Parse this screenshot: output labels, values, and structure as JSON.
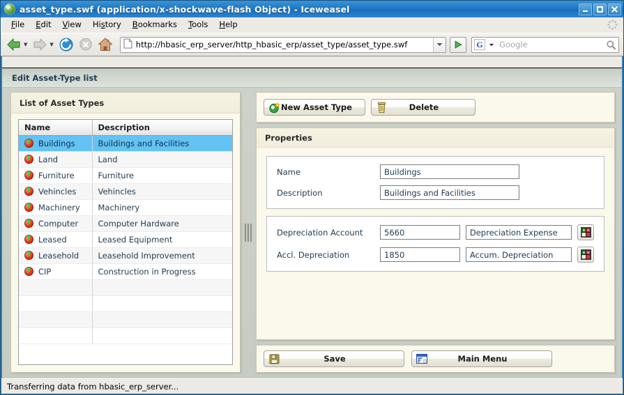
{
  "window": {
    "title": "asset_type.swf (application/x-shockwave-flash Object) - Iceweasel",
    "app_icon": "globe-icon",
    "minimize_label": "minimize-icon",
    "maximize_label": "maximize-icon",
    "close_label": "close-icon"
  },
  "menubar": {
    "items": [
      {
        "label": "File",
        "accel": "F"
      },
      {
        "label": "Edit",
        "accel": "E"
      },
      {
        "label": "View",
        "accel": "V"
      },
      {
        "label": "History",
        "accel": "s"
      },
      {
        "label": "Bookmarks",
        "accel": "B"
      },
      {
        "label": "Tools",
        "accel": "T"
      },
      {
        "label": "Help",
        "accel": "H"
      }
    ],
    "throbber": "throbber-icon"
  },
  "navbar": {
    "back": "back-arrow-icon",
    "forward": "forward-arrow-icon",
    "reload": "reload-icon",
    "stop": "stop-icon",
    "home": "home-icon",
    "url_value": "http://hbasic_erp_server/http_hbasic_erp/asset_type/asset_type.swf",
    "url_icon": "page-icon",
    "go": "go-icon",
    "search_engine": "G",
    "search_placeholder": "Google",
    "search_value": "",
    "search_icon": "magnifier-icon"
  },
  "app": {
    "header_title": "Edit Asset-Type list",
    "left": {
      "title": "List of Asset Types",
      "columns": [
        "Name",
        "Description"
      ],
      "rows": [
        {
          "icon": "asset-type-icon",
          "name": "Buildings",
          "description": "Buildings and Facilities",
          "selected": true
        },
        {
          "icon": "asset-type-icon",
          "name": "Land",
          "description": "Land",
          "selected": false
        },
        {
          "icon": "asset-type-icon",
          "name": "Furniture",
          "description": "Furniture",
          "selected": false
        },
        {
          "icon": "asset-type-icon",
          "name": "Vehincles",
          "description": "Vehincles",
          "selected": false
        },
        {
          "icon": "asset-type-icon",
          "name": "Machinery",
          "description": "Machinery",
          "selected": false
        },
        {
          "icon": "asset-type-icon",
          "name": "Computer",
          "description": "Computer Hardware",
          "selected": false
        },
        {
          "icon": "asset-type-icon",
          "name": "Leased",
          "description": "Leased Equipment",
          "selected": false
        },
        {
          "icon": "asset-type-icon",
          "name": "Leasehold",
          "description": "Leasehold Improvement",
          "selected": false
        },
        {
          "icon": "asset-type-icon",
          "name": "CIP",
          "description": "Construction in Progress",
          "selected": false
        }
      ],
      "empty_rows": 4
    },
    "toolbar": {
      "new_label": "New Asset Type",
      "new_icon": "new-item-icon",
      "delete_label": "Delete",
      "delete_icon": "trash-icon"
    },
    "properties": {
      "title": "Properties",
      "name_label": "Name",
      "name_value": "Buildings",
      "description_label": "Description",
      "description_value": "Buildings and Facilities",
      "depreciation_account_label": "Depreciation Account",
      "depreciation_account_value": "5660",
      "depreciation_account_name": "Depreciation Expense",
      "depreciation_account_picker": "account-picker-icon",
      "accl_depreciation_label": "Accl. Depreciation",
      "accl_depreciation_value": "1850",
      "accl_depreciation_name": "Accum. Depreciation",
      "accl_depreciation_picker": "account-picker-icon"
    },
    "bottom": {
      "save_label": "Save",
      "save_icon": "floppy-disk-icon",
      "main_menu_label": "Main Menu",
      "main_menu_icon": "main-menu-icon"
    }
  },
  "statusbar": {
    "text": "Transferring data from hbasic_erp_server..."
  },
  "colors": {
    "titlebar": "#1f79c6",
    "selection": "#64c3f5",
    "panel": "#fbf8ec",
    "app_bg": "#c9cfc7",
    "label_text": "#1e3b52"
  }
}
